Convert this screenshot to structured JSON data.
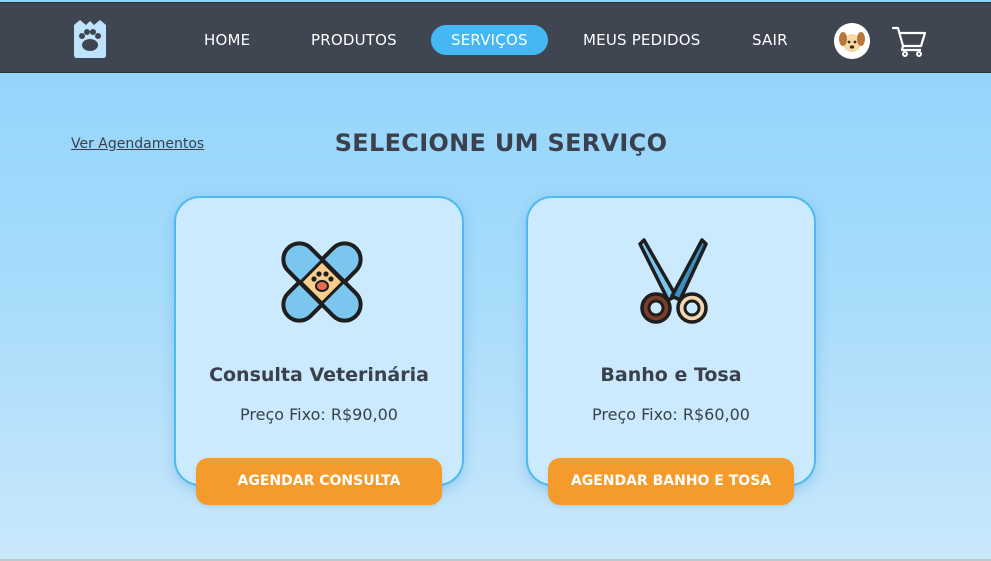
{
  "nav": {
    "logo_icon": "paw-logo-icon",
    "links": [
      {
        "label": "HOME"
      },
      {
        "label": "PRODUTOS"
      },
      {
        "label": "SERVIÇOS"
      },
      {
        "label": "MEUS PEDIDOS"
      },
      {
        "label": "SAIR"
      }
    ],
    "active": "SERVIÇOS",
    "avatar_icon": "dog-avatar-icon",
    "cart_icon": "cart-icon",
    "colors": {
      "background": "#3f4551",
      "active": "#45b8f4"
    }
  },
  "main": {
    "ver_agendamentos": "Ver Agendamentos",
    "title": "SELECIONE UM SERVIÇO",
    "cards": [
      {
        "icon": "bandage-paw-icon",
        "title": "Consulta Veterinária",
        "price": "Preço Fixo: R$90,00",
        "button": "AGENDAR CONSULTA"
      },
      {
        "icon": "scissors-icon",
        "title": "Banho e Tosa",
        "price": "Preço Fixo: R$60,00",
        "button": "AGENDAR BANHO E TOSA"
      }
    ],
    "colors": {
      "button": "#f59b2b",
      "card_border": "#4fb9f0",
      "card_bg": "#cbeafd"
    }
  }
}
